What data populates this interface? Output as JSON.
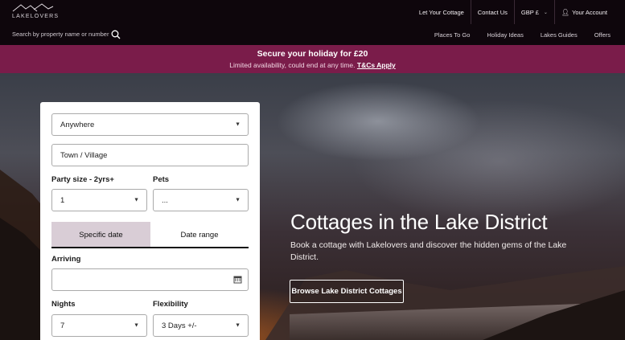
{
  "brand": {
    "name": "LAKELOVERS"
  },
  "topnav": {
    "let_cottage": "Let Your Cottage",
    "contact": "Contact Us",
    "currency": "GBP £",
    "account": "Your Account"
  },
  "search": {
    "placeholder": "Search by property name or number"
  },
  "subnav": {
    "items": [
      "Places To Go",
      "Holiday Ideas",
      "Lakes Guides",
      "Offers"
    ]
  },
  "promo": {
    "title": "Secure your holiday for £20",
    "subtitle": "Limited availability, could end at any time.",
    "link": "T&Cs Apply"
  },
  "hero": {
    "title": "Cottages in the Lake District",
    "description": "Book a cottage with Lakelovers and discover the hidden gems of the Lake District.",
    "button": "Browse Lake District Cottages"
  },
  "form": {
    "location_value": "Anywhere",
    "town_value": "Town / Village",
    "party_label": "Party size - 2yrs+",
    "party_value": "1",
    "pets_label": "Pets",
    "pets_value": "...",
    "tab_specific": "Specific date",
    "tab_range": "Date range",
    "arriving_label": "Arriving",
    "arriving_value": "",
    "nights_label": "Nights",
    "nights_value": "7",
    "flex_label": "Flexibility",
    "flex_value": "3 Days +/-"
  },
  "colors": {
    "topbar": "#0e060c",
    "promo": "#7a1c4a",
    "tab_active": "#d9cdd6"
  }
}
